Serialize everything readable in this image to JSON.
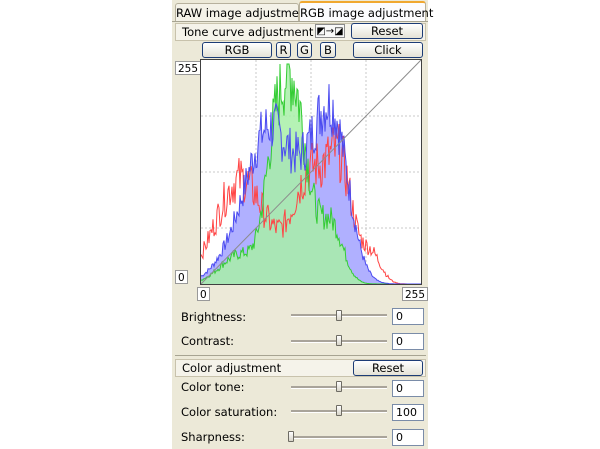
{
  "tabs": {
    "raw_label": "RAW image adjustment",
    "rgb_label": "RGB image adjustment"
  },
  "tone_curve": {
    "header": "Tone curve adjustment",
    "reset_label": "Reset",
    "icon_symbol": "◩→◪",
    "channels": [
      "RGB",
      "R",
      "G",
      "B"
    ],
    "click_label": "Click",
    "y_max_label": "255",
    "y_min_label": "0",
    "x_min_label": "0",
    "x_max_label": "255"
  },
  "basic": {
    "brightness_label": "Brightness:",
    "brightness_value": "0",
    "brightness_level": 0.5,
    "contrast_label": "Contrast:",
    "contrast_value": "0",
    "contrast_level": 0.5
  },
  "color": {
    "header": "Color adjustment",
    "reset_label": "Reset",
    "tone_label": "Color tone:",
    "tone_value": "0",
    "tone_level": 0.5,
    "saturation_label": "Color saturation:",
    "saturation_value": "100",
    "saturation_level": 0.5,
    "sharpness_label": "Sharpness:",
    "sharpness_value": "0",
    "sharpness_level": 0.0
  },
  "colors": {
    "red_channel": "#ff4444",
    "green_channel": "#33cc33",
    "blue_channel": "#4a4af0",
    "blue_fill": "#b0b0ff",
    "green_fill": "#a8f0a8",
    "tab_accent": "#f0a830"
  }
}
